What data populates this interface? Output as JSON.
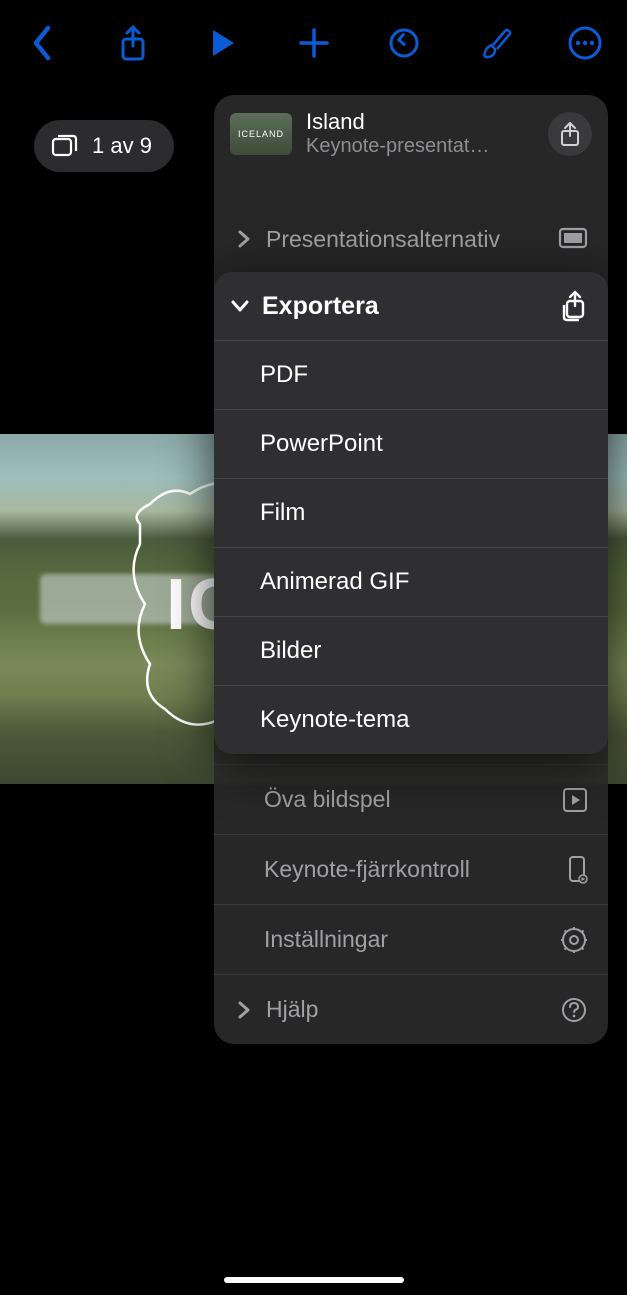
{
  "toolbar": {
    "back_name": "back",
    "share_name": "share",
    "play_name": "play",
    "add_name": "add",
    "undo_name": "undo",
    "brush_name": "format",
    "more_name": "more"
  },
  "slide_counter": {
    "label": "1 av 9"
  },
  "slide_bg": {
    "title_fragment": "IC"
  },
  "panel": {
    "thumb_label": "ICELAND",
    "title": "Island",
    "subtitle": "Keynote-presentat…",
    "rows": {
      "presentation_options": "Presentationsalternativ",
      "practice": "Öva bildspel",
      "remote": "Keynote-fjärrkontroll",
      "settings": "Inställningar",
      "help": "Hjälp"
    }
  },
  "export": {
    "header": "Exportera",
    "items": [
      "PDF",
      "PowerPoint",
      "Film",
      "Animerad GIF",
      "Bilder",
      "Keynote-tema"
    ]
  }
}
